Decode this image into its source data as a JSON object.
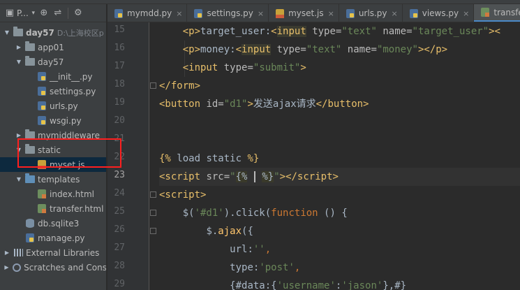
{
  "panel": {
    "title": "P...",
    "tree": [
      {
        "label": "day57",
        "hint": "D:\\上海校区p",
        "depth": 0,
        "type": "folder",
        "expanded": true
      },
      {
        "label": "app01",
        "depth": 1,
        "type": "folder",
        "expanded": false
      },
      {
        "label": "day57",
        "depth": 1,
        "type": "folder",
        "expanded": true
      },
      {
        "label": "__init__.py",
        "depth": 2,
        "type": "py"
      },
      {
        "label": "settings.py",
        "depth": 2,
        "type": "py"
      },
      {
        "label": "urls.py",
        "depth": 2,
        "type": "py"
      },
      {
        "label": "wsgi.py",
        "depth": 2,
        "type": "py"
      },
      {
        "label": "mymiddleware",
        "depth": 1,
        "type": "folder",
        "expanded": false
      },
      {
        "label": "static",
        "depth": 1,
        "type": "folder",
        "expanded": true
      },
      {
        "label": "myset.js",
        "depth": 2,
        "type": "js",
        "selected": true
      },
      {
        "label": "templates",
        "depth": 1,
        "type": "folder-blue",
        "expanded": true
      },
      {
        "label": "index.html",
        "depth": 2,
        "type": "html"
      },
      {
        "label": "transfer.html",
        "depth": 2,
        "type": "html"
      },
      {
        "label": "db.sqlite3",
        "depth": 1,
        "type": "db"
      },
      {
        "label": "manage.py",
        "depth": 1,
        "type": "py"
      },
      {
        "label": "External Libraries",
        "depth": 0,
        "type": "lib",
        "expanded": false
      },
      {
        "label": "Scratches and Cons",
        "depth": 0,
        "type": "scratch",
        "expanded": false
      }
    ]
  },
  "tabs": [
    {
      "label": "mymdd.py",
      "type": "py"
    },
    {
      "label": "settings.py",
      "type": "py"
    },
    {
      "label": "myset.js",
      "type": "js"
    },
    {
      "label": "urls.py",
      "type": "py"
    },
    {
      "label": "views.py",
      "type": "py"
    },
    {
      "label": "transfer.ht",
      "type": "html",
      "active": true
    }
  ],
  "editor": {
    "line_numbers": [
      "15",
      "16",
      "17",
      "18",
      "19",
      "20",
      "21",
      "22",
      "23",
      "24",
      "25",
      "26",
      "27",
      "28",
      "29"
    ],
    "current_line": "23"
  },
  "colors": {
    "accent": "#4a88c7",
    "highlight_box": "#ff1f1f"
  }
}
